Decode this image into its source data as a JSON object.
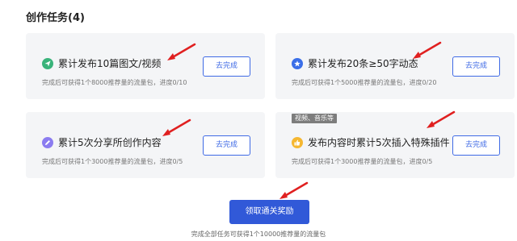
{
  "section": {
    "title": "创作任务(4)"
  },
  "tasks": [
    {
      "title": "累计发布10篇图文/视频",
      "desc": "完成后可获得1个8000推荐量的流量包，进度0/10",
      "button": "去完成",
      "icon": "send-icon",
      "icon_color": "#39b37a"
    },
    {
      "title": "累计发布20条≥50字动态",
      "desc": "完成后可获得1个5000推荐量的流量包，进度0/20",
      "button": "去完成",
      "icon": "star-icon",
      "icon_color": "#3a6ee8"
    },
    {
      "title": "累计5次分享所创作内容",
      "desc": "完成后可获得1个3000推荐量的流量包，进度0/5",
      "button": "去完成",
      "icon": "pencil-icon",
      "icon_color": "#8b7cf0"
    },
    {
      "title": "发布内容时累计5次插入特殊插件",
      "desc": "完成后可获得1个3000推荐量的流量包，进度0/5",
      "button": "去完成",
      "icon": "thumbs-up-icon",
      "icon_color": "#f5b731",
      "tag": "视频、音乐等"
    }
  ],
  "claim": {
    "label": "领取通关奖励",
    "note": "完成全部任务可获得1个10000推荐量的流量包"
  },
  "colors": {
    "accent": "#3f6ae5",
    "primary_button": "#3159d8",
    "card_bg": "#f4f5f7",
    "annotation_arrow": "#e02020"
  }
}
